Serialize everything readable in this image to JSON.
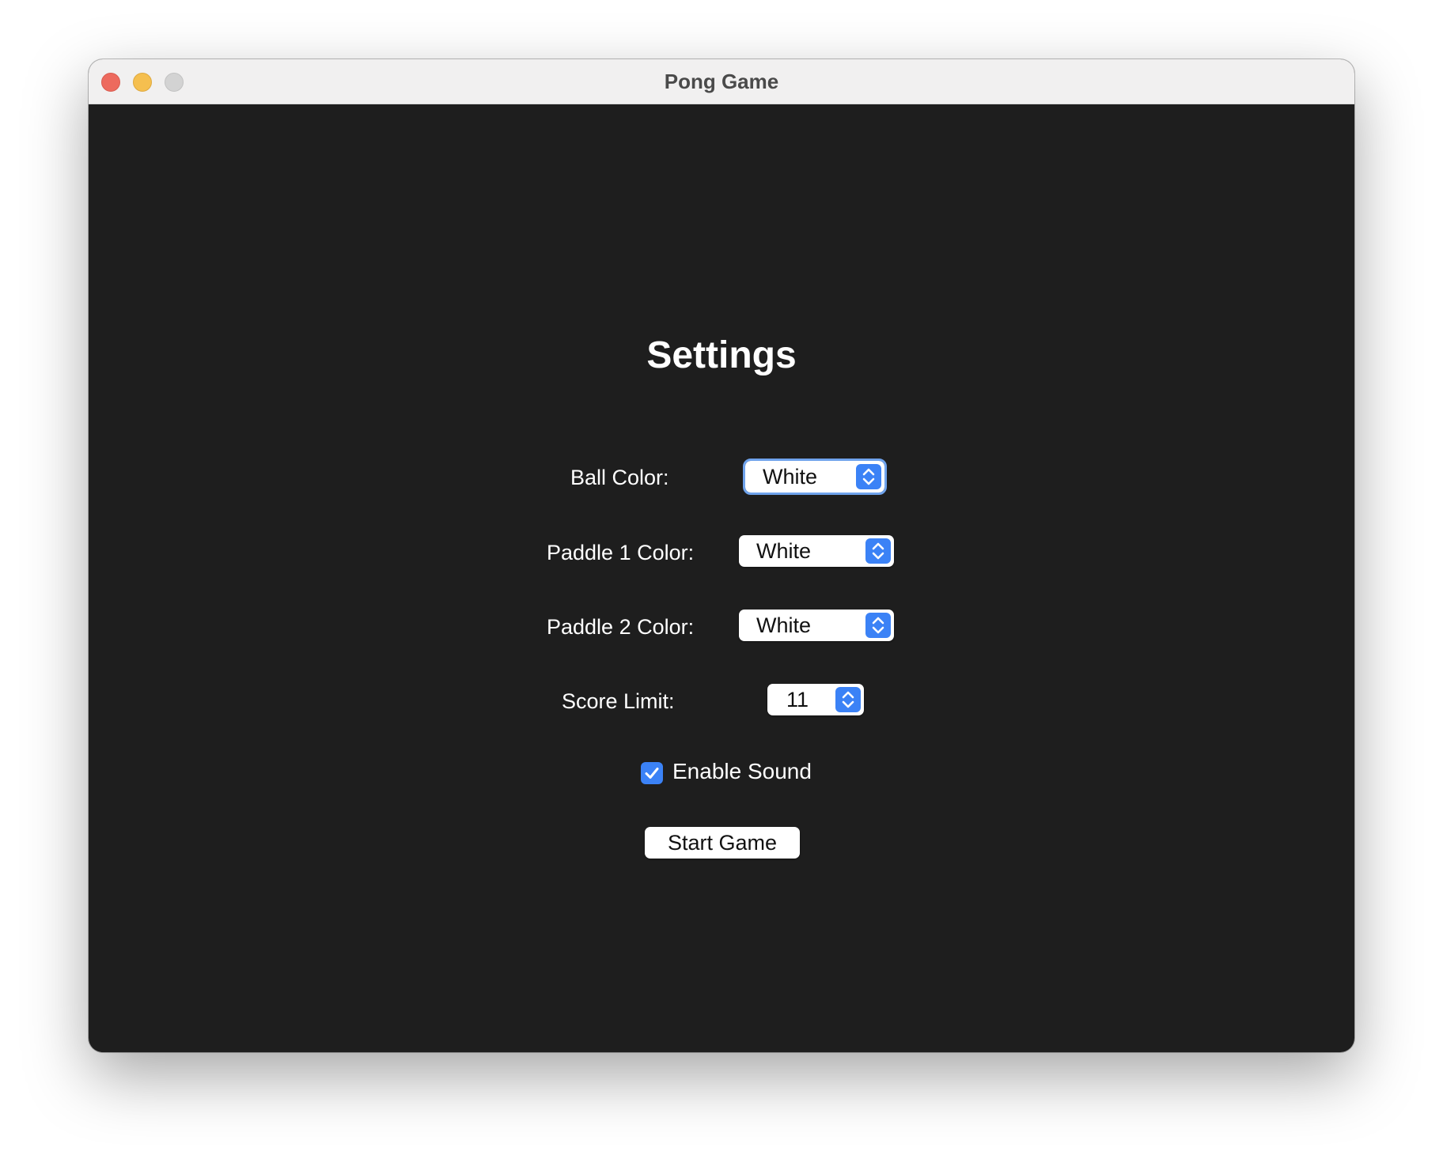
{
  "window": {
    "title": "Pong Game"
  },
  "settings": {
    "heading": "Settings",
    "ball_color": {
      "label": "Ball Color:",
      "value": "White"
    },
    "paddle1_color": {
      "label": "Paddle 1 Color:",
      "value": "White"
    },
    "paddle2_color": {
      "label": "Paddle 2 Color:",
      "value": "White"
    },
    "score_limit": {
      "label": "Score Limit:",
      "value": "11"
    },
    "enable_sound": {
      "label": "Enable Sound",
      "checked": true
    },
    "start_button": "Start Game"
  },
  "colors": {
    "accent": "#3b82f6",
    "background": "#1e1e1e",
    "titlebar": "#f1f0f0"
  },
  "icons": {
    "stepper": "up-down-chevron-icon",
    "checkbox": "checkmark-icon"
  }
}
